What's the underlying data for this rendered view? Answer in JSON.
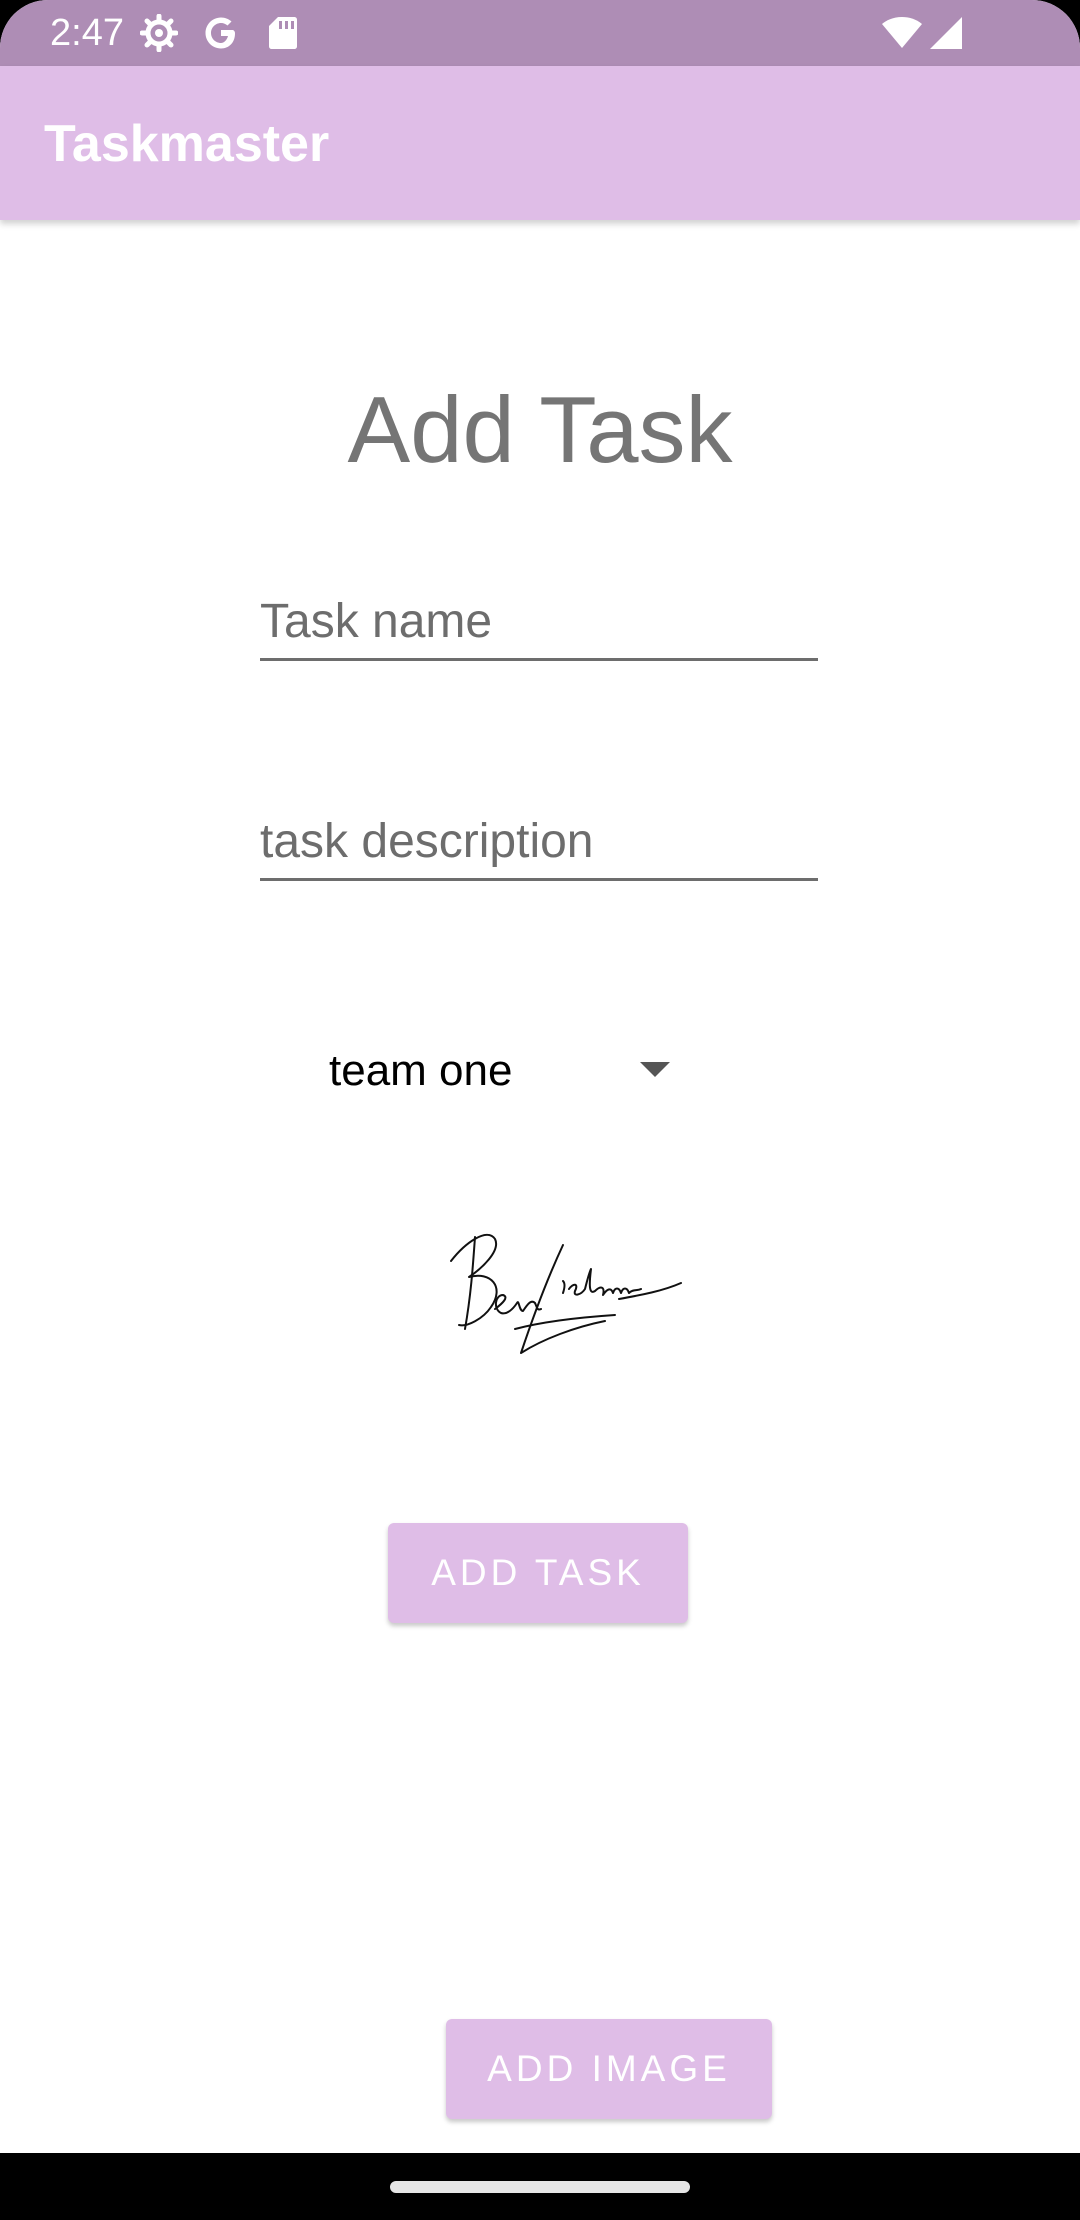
{
  "status_bar": {
    "time": "2:47",
    "icons": [
      "settings-gear-icon",
      "google-g-icon",
      "sd-card-icon",
      "wifi-icon",
      "cell-signal-icon"
    ],
    "color": "#ae8db5"
  },
  "app_bar": {
    "title": "Taskmaster",
    "color": "#dfbde7"
  },
  "form": {
    "heading": "Add Task",
    "task_name": {
      "value": "",
      "placeholder": "Task name"
    },
    "task_description": {
      "value": "",
      "placeholder": "task description"
    },
    "team_select": {
      "selected": "team one"
    },
    "signature_image": {
      "icon": "handwritten-signature-image"
    },
    "add_task_label": "ADD TASK",
    "add_image_label": "ADD IMAGE",
    "button_color": "#dfbde7"
  },
  "nav_bar": {
    "handle": "home-gesture-handle"
  }
}
